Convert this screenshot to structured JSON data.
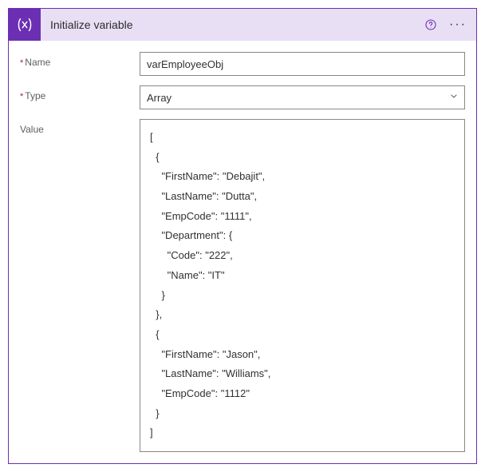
{
  "header": {
    "title": "Initialize variable"
  },
  "fields": {
    "name_label": "Name",
    "name_value": "varEmployeeObj",
    "type_label": "Type",
    "type_value": "Array",
    "value_label": "Value",
    "value_text": "[\n  {\n    \"FirstName\": \"Debajit\",\n    \"LastName\": \"Dutta\",\n    \"EmpCode\": \"1111\",\n    \"Department\": {\n      \"Code\": \"222\",\n      \"Name\": \"IT\"\n    }\n  },\n  {\n    \"FirstName\": \"Jason\",\n    \"LastName\": \"Williams\",\n    \"EmpCode\": \"1112\"\n  }\n]"
  }
}
